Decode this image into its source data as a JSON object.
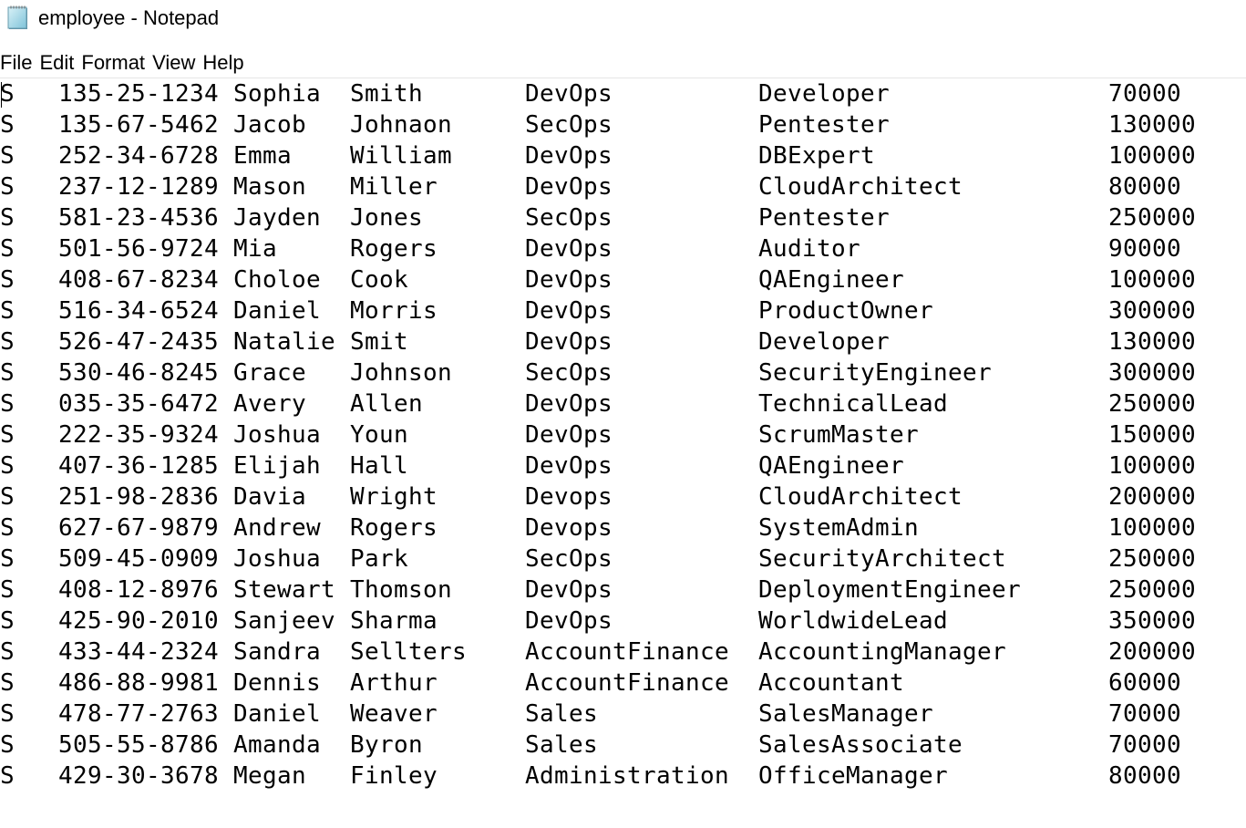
{
  "window": {
    "title": "employee - Notepad",
    "icon": "notepad-icon"
  },
  "menu": [
    "File",
    "Edit",
    "Format",
    "View",
    "Help"
  ],
  "document": {
    "rows": [
      {
        "code": "S",
        "ssn": "135-25-1234",
        "first": "Sophia",
        "last": "Smith",
        "dept": "DevOps",
        "role": "Developer",
        "salary": "70000"
      },
      {
        "code": "S",
        "ssn": "135-67-5462",
        "first": "Jacob",
        "last": "Johnaon",
        "dept": "SecOps",
        "role": "Pentester",
        "salary": "130000"
      },
      {
        "code": "S",
        "ssn": "252-34-6728",
        "first": "Emma",
        "last": "William",
        "dept": "DevOps",
        "role": "DBExpert",
        "salary": "100000"
      },
      {
        "code": "S",
        "ssn": "237-12-1289",
        "first": "Mason",
        "last": "Miller",
        "dept": "DevOps",
        "role": "CloudArchitect",
        "salary": "80000"
      },
      {
        "code": "S",
        "ssn": "581-23-4536",
        "first": "Jayden",
        "last": "Jones",
        "dept": "SecOps",
        "role": "Pentester",
        "salary": "250000"
      },
      {
        "code": "S",
        "ssn": "501-56-9724",
        "first": "Mia",
        "last": "Rogers",
        "dept": "DevOps",
        "role": "Auditor",
        "salary": "90000"
      },
      {
        "code": "S",
        "ssn": "408-67-8234",
        "first": "Choloe",
        "last": "Cook",
        "dept": "DevOps",
        "role": "QAEngineer",
        "salary": "100000"
      },
      {
        "code": "S",
        "ssn": "516-34-6524",
        "first": "Daniel",
        "last": "Morris",
        "dept": "DevOps",
        "role": "ProductOwner",
        "salary": "300000"
      },
      {
        "code": "S",
        "ssn": "526-47-2435",
        "first": "Natalie",
        "last": "Smit",
        "dept": "DevOps",
        "role": "Developer",
        "salary": "130000"
      },
      {
        "code": "S",
        "ssn": "530-46-8245",
        "first": "Grace",
        "last": "Johnson",
        "dept": "SecOps",
        "role": "SecurityEngineer",
        "salary": "300000"
      },
      {
        "code": "S",
        "ssn": "035-35-6472",
        "first": "Avery",
        "last": "Allen",
        "dept": "DevOps",
        "role": "TechnicalLead",
        "salary": "250000"
      },
      {
        "code": "S",
        "ssn": "222-35-9324",
        "first": "Joshua",
        "last": "Youn",
        "dept": "DevOps",
        "role": "ScrumMaster",
        "salary": "150000"
      },
      {
        "code": "S",
        "ssn": "407-36-1285",
        "first": "Elijah",
        "last": "Hall",
        "dept": "DevOps",
        "role": "QAEngineer",
        "salary": "100000"
      },
      {
        "code": "S",
        "ssn": "251-98-2836",
        "first": "Davia",
        "last": "Wright",
        "dept": "Devops",
        "role": "CloudArchitect",
        "salary": "200000"
      },
      {
        "code": "S",
        "ssn": "627-67-9879",
        "first": "Andrew",
        "last": "Rogers",
        "dept": "Devops",
        "role": "SystemAdmin",
        "salary": "100000"
      },
      {
        "code": "S",
        "ssn": "509-45-0909",
        "first": "Joshua",
        "last": "Park",
        "dept": "SecOps",
        "role": "SecurityArchitect",
        "salary": "250000"
      },
      {
        "code": "S",
        "ssn": "408-12-8976",
        "first": "Stewart",
        "last": "Thomson",
        "dept": "DevOps",
        "role": "DeploymentEngineer",
        "salary": "250000"
      },
      {
        "code": "S",
        "ssn": "425-90-2010",
        "first": "Sanjeev",
        "last": "Sharma",
        "dept": "DevOps",
        "role": "WorldwideLead",
        "salary": "350000"
      },
      {
        "code": "S",
        "ssn": "433-44-2324",
        "first": "Sandra",
        "last": "Sellters",
        "dept": "AccountFinance",
        "role": "AccountingManager",
        "salary": "200000"
      },
      {
        "code": "S",
        "ssn": "486-88-9981",
        "first": "Dennis",
        "last": "Arthur",
        "dept": "AccountFinance",
        "role": "Accountant",
        "salary": "60000"
      },
      {
        "code": "S",
        "ssn": "478-77-2763",
        "first": "Daniel",
        "last": "Weaver",
        "dept": "Sales",
        "role": "SalesManager",
        "salary": "70000"
      },
      {
        "code": "S",
        "ssn": "505-55-8786",
        "first": "Amanda",
        "last": "Byron",
        "dept": "Sales",
        "role": "SalesAssociate",
        "salary": "70000"
      },
      {
        "code": "S",
        "ssn": "429-30-3678",
        "first": "Megan",
        "last": "Finley",
        "dept": "Administration",
        "role": "OfficeManager",
        "salary": "80000"
      }
    ]
  }
}
